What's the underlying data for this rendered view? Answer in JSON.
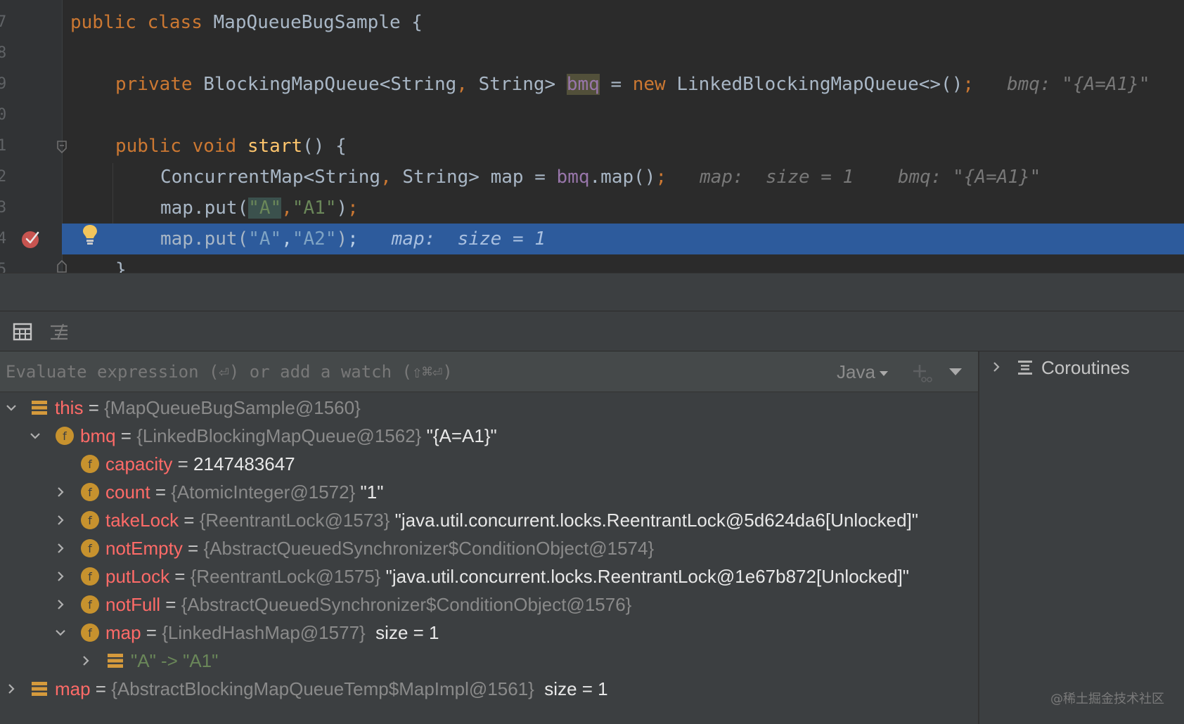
{
  "editor": {
    "line_numbers": [
      "7",
      "8",
      "9",
      "0",
      "1",
      "2",
      "3",
      "4",
      "5"
    ],
    "line1": {
      "kw1": "public",
      "kw2": "class",
      "name": "MapQueueBugSample",
      "brace": "{"
    },
    "line3": {
      "kw": "private",
      "type1": "BlockingMapQueue<String",
      "comma": ",",
      "type2": "String>",
      "field": "bmq",
      "eq": "=",
      "kw_new": "new",
      "ctor": "LinkedBlockingMapQueue<>()",
      "semi": ";",
      "hint": "bmq: \"{A=A1}\""
    },
    "line5": {
      "kw1": "public",
      "kw2": "void",
      "method": "start",
      "rest": "() {"
    },
    "line6": {
      "type1": "ConcurrentMap<String",
      "comma": ",",
      "type2": "String> map =",
      "field": "bmq",
      "call": ".map()",
      "semi": ";",
      "hint1": "map:  size = 1",
      "hint2": "bmq: \"{A=A1}\""
    },
    "line7": {
      "call": "map.put(",
      "arg1": "\"A\"",
      "comma": ",",
      "arg2": "\"A1\"",
      "close": ")",
      "semi": ";"
    },
    "line8": {
      "call": "map.put(",
      "arg1": "\"A\"",
      "comma": ",",
      "arg2": "\"A2\"",
      "close": ")",
      "semi": ";",
      "hint": "map:  size = 1"
    },
    "line9": {
      "brace": "}"
    }
  },
  "eval": {
    "placeholder": "Evaluate expression (⏎) or add a watch (⇧⌘⏎)",
    "language": "Java"
  },
  "variables": [
    {
      "name": "this",
      "type": "{MapQueueBugSample@1560}",
      "value": ""
    },
    {
      "name": "bmq",
      "type": "{LinkedBlockingMapQueue@1562}",
      "value": "\"{A=A1}\""
    },
    {
      "name": "capacity",
      "type": "",
      "value": "2147483647"
    },
    {
      "name": "count",
      "type": "{AtomicInteger@1572}",
      "value": "\"1\""
    },
    {
      "name": "takeLock",
      "type": "{ReentrantLock@1573}",
      "value": "\"java.util.concurrent.locks.ReentrantLock@5d624da6[Unlocked]\""
    },
    {
      "name": "notEmpty",
      "type": "{AbstractQueuedSynchronizer$ConditionObject@1574}",
      "value": ""
    },
    {
      "name": "putLock",
      "type": "{ReentrantLock@1575}",
      "value": "\"java.util.concurrent.locks.ReentrantLock@1e67b872[Unlocked]\""
    },
    {
      "name": "notFull",
      "type": "{AbstractQueuedSynchronizer$ConditionObject@1576}",
      "value": ""
    },
    {
      "name": "map",
      "type": "{LinkedHashMap@1577}",
      "value": "size = 1"
    },
    {
      "name": "",
      "type": "",
      "value": "\"A\" -> \"A1\""
    },
    {
      "name": "map",
      "type": "{AbstractBlockingMapQueueTemp$MapImpl@1561}",
      "value": "size = 1"
    }
  ],
  "right_pane": {
    "coroutines_label": "Coroutines"
  },
  "watermark": "@稀土掘金技术社区",
  "colors": {
    "editor_bg": "#2b2b2b",
    "execution_line": "#2d5b9c",
    "keyword": "#cc7832",
    "field": "#9876aa",
    "string": "#6a8759",
    "method": "#ffc66d",
    "var_name": "#ff6b68",
    "field_badge": "#c7922e"
  },
  "icons": {
    "breakpoint": "breakpoint-check-icon",
    "intention": "lightbulb-icon",
    "fold": "fold-marker-icon",
    "table_view": "table-view-icon",
    "layout": "layout-settings-icon",
    "add_watch": "add-watch-icon",
    "field": "field-f-icon",
    "object": "object-stack-icon",
    "threads": "threads-icon"
  }
}
